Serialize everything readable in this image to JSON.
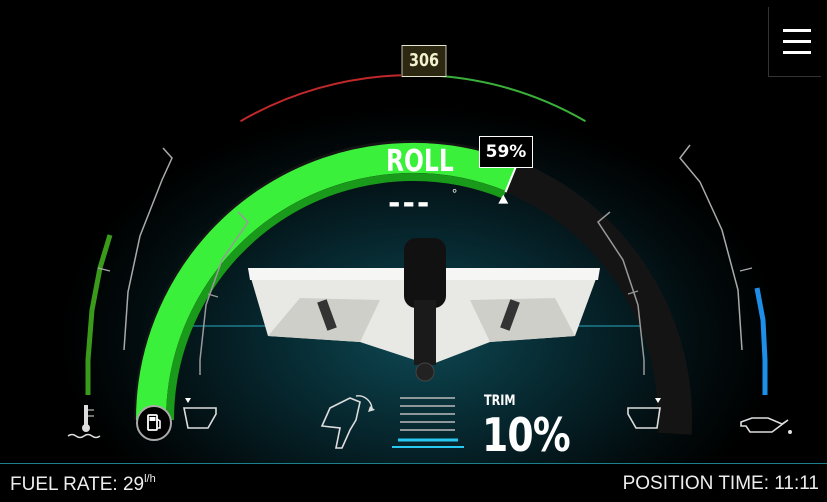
{
  "speed": {
    "value": "306"
  },
  "throttle": {
    "label": "59%",
    "fraction": 0.59
  },
  "roll": {
    "label": "ROLL",
    "value": "---",
    "unit": "°"
  },
  "trim": {
    "label": "TRIM",
    "value": "10%",
    "fraction": 0.1
  },
  "fuel_level": {
    "fraction": 0.78
  },
  "engine_temp": {
    "fraction": 0.72
  },
  "oil_pressure": {
    "fraction": 0.55
  },
  "footer": {
    "fuel_rate_label": "FUEL RATE:",
    "fuel_rate_value": "29",
    "fuel_rate_unit": "l/h",
    "position_time_label": "POSITION TIME:",
    "position_time_value": "11:11"
  },
  "colors": {
    "throttle_green": "#3bf03b",
    "fuel_green": "#3a9a1a",
    "oil_blue": "#1d8fe8",
    "speed_red": "#c0282a",
    "speed_green": "#3ab03a",
    "trim_blue": "#29c8f0"
  },
  "icons": {
    "fuel": "fuel-pump-icon",
    "temp": "engine-temp-icon",
    "oil": "oil-can-icon",
    "tilt": "engine-tilt-icon",
    "menu": "hamburger-menu-icon"
  }
}
